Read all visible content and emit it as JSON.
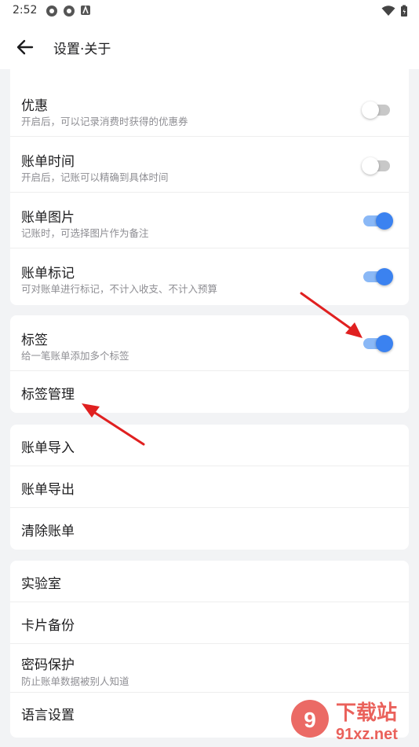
{
  "status_bar": {
    "time": "2:52"
  },
  "header": {
    "title": "设置·关于"
  },
  "sections": [
    {
      "rows": [
        {
          "title": "优惠",
          "subtitle": "开启后，可以记录消费时获得的优惠券",
          "toggle": false
        },
        {
          "title": "账单时间",
          "subtitle": "开启后，记账可以精确到具体时间",
          "toggle": false
        },
        {
          "title": "账单图片",
          "subtitle": "记账时，可选择图片作为备注",
          "toggle": true
        },
        {
          "title": "账单标记",
          "subtitle": "可对账单进行标记，不计入收支、不计入预算",
          "toggle": true
        }
      ]
    },
    {
      "rows": [
        {
          "title": "标签",
          "subtitle": "给一笔账单添加多个标签",
          "toggle": true
        },
        {
          "title": "标签管理"
        }
      ]
    },
    {
      "rows": [
        {
          "title": "账单导入"
        },
        {
          "title": "账单导出"
        },
        {
          "title": "清除账单"
        }
      ]
    },
    {
      "rows": [
        {
          "title": "实验室"
        },
        {
          "title": "卡片备份"
        },
        {
          "title": "密码保护",
          "subtitle": "防止账单数据被别人知道"
        },
        {
          "title": "语言设置"
        }
      ]
    }
  ],
  "watermark": {
    "brand": "下载站",
    "url": "91xz.net"
  },
  "colors": {
    "accent": "#3b82f0",
    "annotation_arrow": "#e02020"
  }
}
